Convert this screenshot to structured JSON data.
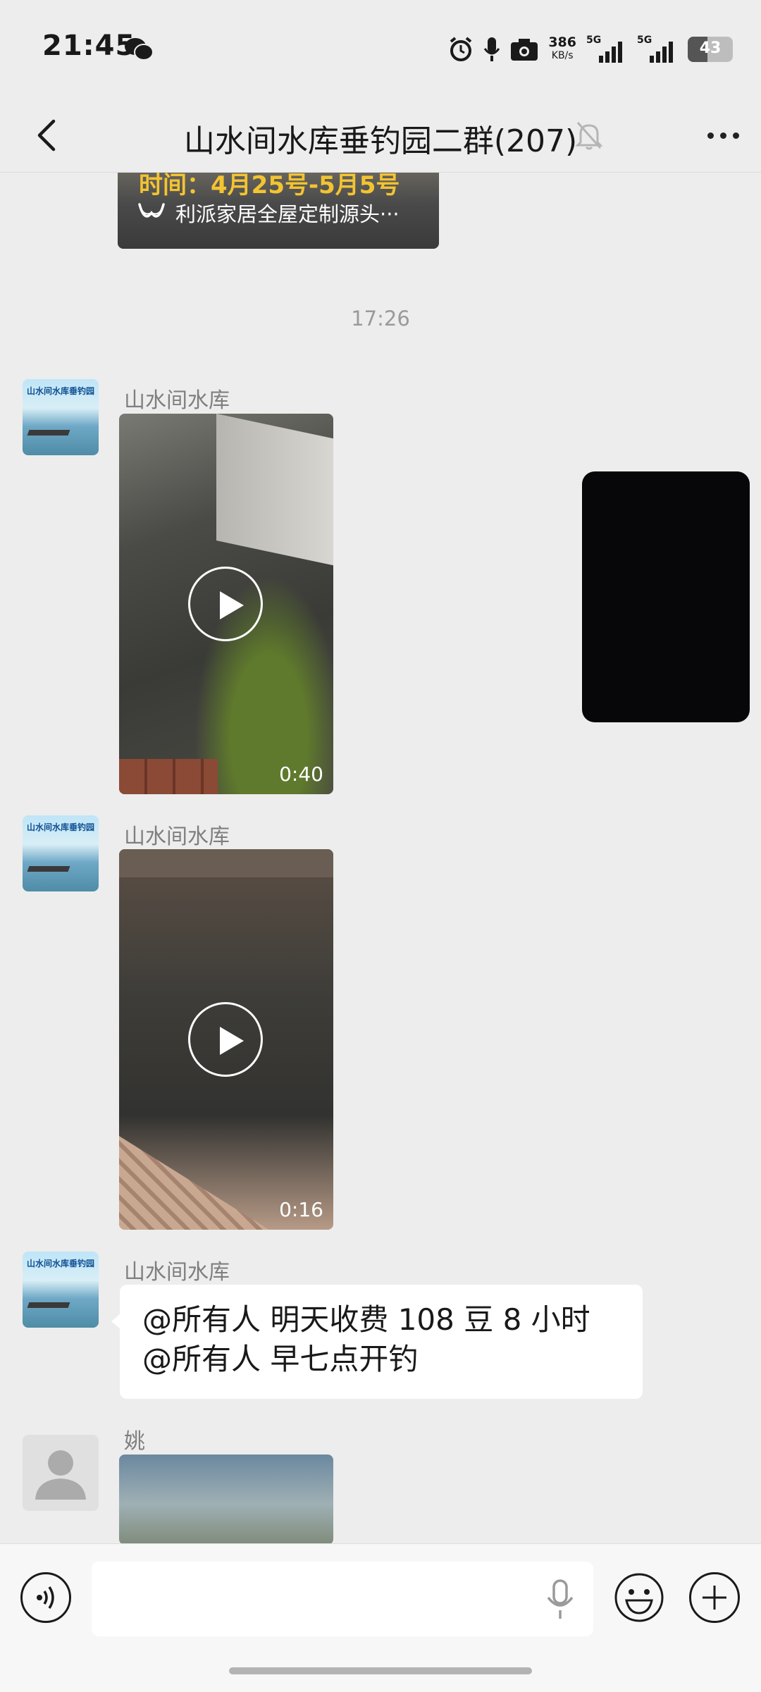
{
  "status_bar": {
    "time": "21:45",
    "speed_value": "386",
    "speed_unit": "KB/s",
    "sim1": "5G",
    "sim2": "5G",
    "battery": "43",
    "battery_level": 0.43
  },
  "nav": {
    "title": "山水间水库垂钓园二群(207)",
    "muted": true
  },
  "messages": {
    "link_card_banner": "时间：4月25号-5月5号",
    "link_card_source": "利派家居全屋定制源头···",
    "timestamp": "17:26",
    "avatar_brand": "山水间水库垂钓园",
    "video1": {
      "sender": "山水间水库",
      "duration": "0:40"
    },
    "video2": {
      "sender": "山水间水库",
      "duration": "0:16"
    },
    "text_msg": {
      "sender": "山水间水库",
      "line1": "@所有人  明天收费 108 豆 8 小时",
      "line2": "@所有人  早七点开钓"
    },
    "video3": {
      "sender": "姚"
    }
  },
  "input_bar": {
    "placeholder": ""
  },
  "colors": {
    "background": "#ededed",
    "bubble": "#ffffff",
    "accent_banner": "#f3c431"
  }
}
